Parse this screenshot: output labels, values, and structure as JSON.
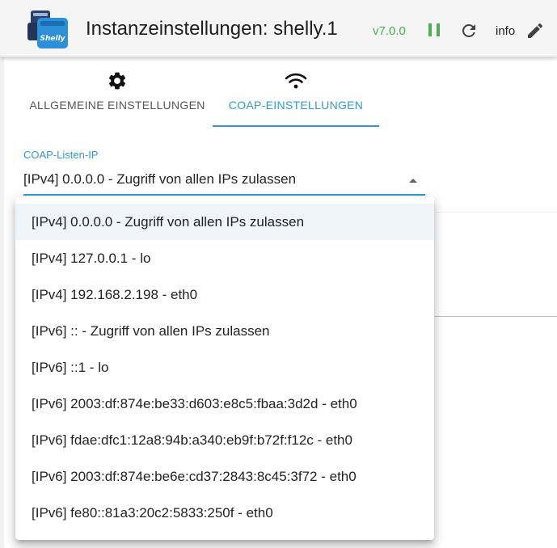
{
  "header": {
    "title": "Instanzeinstellungen: shelly.1",
    "version": "v7.0.0",
    "info_label": "info",
    "logo_icon": "shelly-logo",
    "logo_text": "Shelly",
    "pause_icon": "pause-icon",
    "refresh_icon": "refresh-icon",
    "edit_icon": "pencil-icon",
    "version_color": "#4caf50"
  },
  "tabs": [
    {
      "label": "ALLGEMEINE EINSTELLUNGEN",
      "icon": "gear-icon",
      "active": false
    },
    {
      "label": "COAP-EINSTELLUNGEN",
      "icon": "wifi-icon",
      "active": true
    }
  ],
  "form": {
    "coap_listen_ip": {
      "label": "COAP-Listen-IP",
      "value": "[IPv4] 0.0.0.0 - Zugriff von allen IPs zulassen",
      "arrow_icon": "caret-up-icon",
      "options": [
        "[IPv4] 0.0.0.0 - Zugriff von allen IPs zulassen",
        "[IPv4] 127.0.0.1 - lo",
        "[IPv4] 192.168.2.198 - eth0",
        "[IPv6] :: - Zugriff von allen IPs zulassen",
        "[IPv6] ::1 - lo",
        "[IPv6] 2003:df:874e:be33:d603:e8c5:fbaa:3d2d - eth0",
        "[IPv6] fdae:dfc1:12a8:94b:a340:eb9f:b72f:f12c - eth0",
        "[IPv6] 2003:df:874e:be6e:cd37:2843:8c45:3f72 - eth0",
        "[IPv6] fe80::81a3:20c2:5833:250f - eth0"
      ],
      "selected_index": 0
    }
  },
  "colors": {
    "accent": "#3399cc",
    "selected_option_bg": "#eef4f8"
  }
}
